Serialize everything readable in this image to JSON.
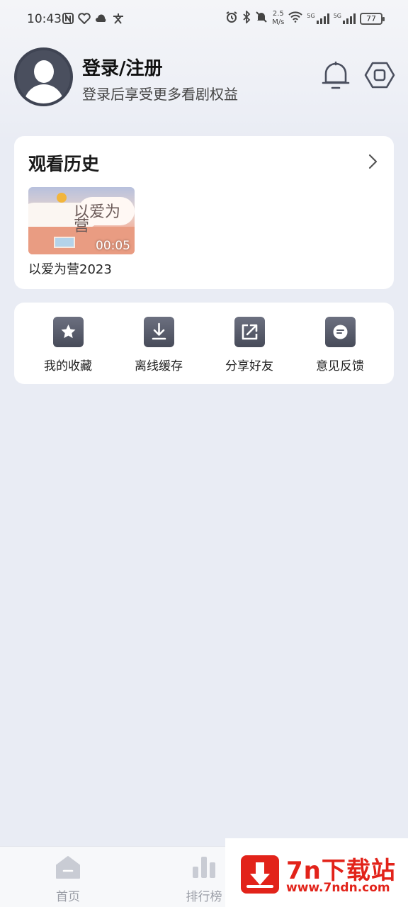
{
  "status_bar": {
    "time": "10:43",
    "left_icons": [
      "nfc-icon",
      "health-icon",
      "cloud-icon",
      "wen-icon"
    ],
    "speed_value": "2.5",
    "speed_unit": "M/s",
    "network_labels": [
      "5G",
      "5G"
    ],
    "battery": "77"
  },
  "header": {
    "title": "登录/注册",
    "subtitle": "登录后享受更多看剧权益",
    "icons": [
      "bell-icon",
      "settings-icon"
    ]
  },
  "history": {
    "title": "观看历史",
    "items": [
      {
        "title": "以爱为营2023",
        "duration": "00:05",
        "thumb_text": "以爱为营"
      }
    ]
  },
  "functions": [
    {
      "label": "我的收藏",
      "icon": "star-icon"
    },
    {
      "label": "离线缓存",
      "icon": "download-icon"
    },
    {
      "label": "分享好友",
      "icon": "share-icon"
    },
    {
      "label": "意见反馈",
      "icon": "feedback-icon"
    }
  ],
  "bottom_nav": [
    {
      "label": "首页",
      "icon": "home-icon"
    },
    {
      "label": "排行榜",
      "icon": "rank-icon"
    }
  ],
  "watermark": {
    "brand": "7n下载站",
    "url": "www.7ndn.com"
  },
  "colors": {
    "background": "#e9ecf4",
    "card": "#ffffff",
    "icon_dark": "#4a4f5e",
    "watermark_red": "#e2231a"
  }
}
